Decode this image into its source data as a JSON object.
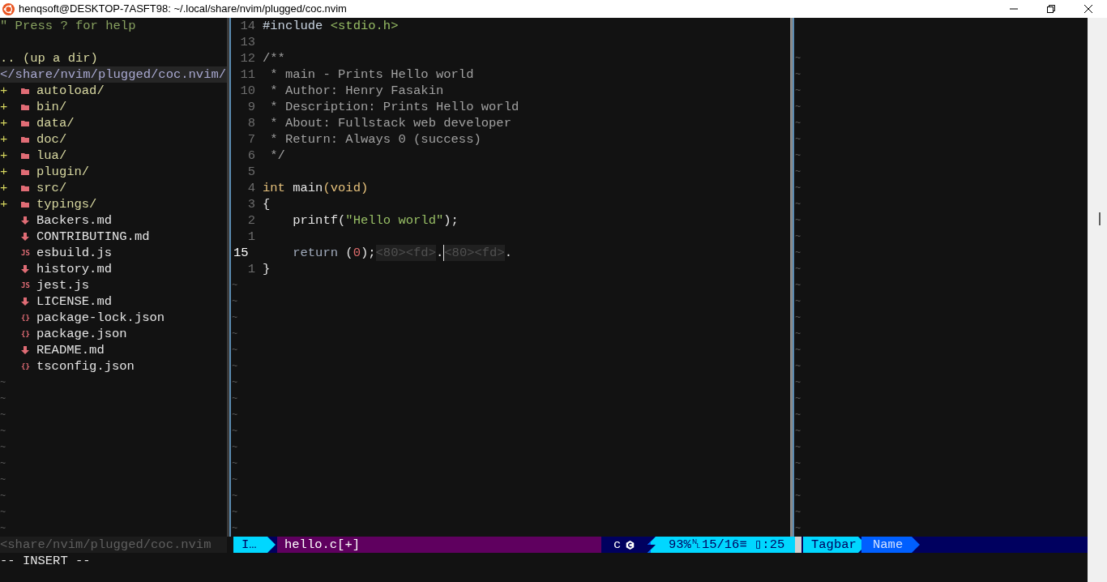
{
  "window": {
    "title": "henqsoft@DESKTOP-7ASFT98: ~/.local/share/nvim/plugged/coc.nvim"
  },
  "tree": {
    "help": "\" Press ? for help",
    "up_dir": ".. (up a dir)",
    "root": {
      "text": "</share/nvim/plugged/coc.nvim/",
      "cursor_line": true
    },
    "entries": [
      {
        "name": "autoload/",
        "kind": "dir",
        "marker": "+"
      },
      {
        "name": "bin/",
        "kind": "dir",
        "marker": "+"
      },
      {
        "name": "data/",
        "kind": "dir",
        "marker": "+"
      },
      {
        "name": "doc/",
        "kind": "dir",
        "marker": "+"
      },
      {
        "name": "lua/",
        "kind": "dir",
        "marker": "+"
      },
      {
        "name": "plugin/",
        "kind": "dir",
        "marker": "+"
      },
      {
        "name": "src/",
        "kind": "dir",
        "marker": "+"
      },
      {
        "name": "typings/",
        "kind": "dir",
        "marker": "+"
      },
      {
        "name": "Backers.md",
        "kind": "markdown"
      },
      {
        "name": "CONTRIBUTING.md",
        "kind": "markdown"
      },
      {
        "name": "esbuild.js",
        "kind": "labeled",
        "icon_text": "JS"
      },
      {
        "name": "history.md",
        "kind": "markdown"
      },
      {
        "name": "jest.js",
        "kind": "labeled",
        "icon_text": "JS"
      },
      {
        "name": "LICENSE.md",
        "kind": "markdown"
      },
      {
        "name": "package-lock.json",
        "kind": "labeled",
        "icon_text": "{}"
      },
      {
        "name": "package.json",
        "kind": "labeled",
        "icon_text": "{}"
      },
      {
        "name": "README.md",
        "kind": "markdown"
      },
      {
        "name": "tsconfig.json",
        "kind": "labeled",
        "icon_text": "{}"
      }
    ],
    "filler": [
      "~",
      "~",
      "~",
      "~",
      "~",
      "~",
      "~",
      "~",
      "~",
      "~"
    ]
  },
  "editor": {
    "lines": [
      {
        "number": "14",
        "current": false,
        "tokens": [
          {
            "text": "#include",
            "kind": "preproc"
          },
          {
            "text": " <stdio.h>",
            "kind": "string"
          }
        ]
      },
      {
        "number": "13",
        "current": false
      },
      {
        "number": "12",
        "current": false,
        "tokens": [
          {
            "text": "/**",
            "kind": "comment"
          }
        ]
      },
      {
        "number": "11",
        "current": false,
        "tokens": [
          {
            "text": " * main - Prints Hello world",
            "kind": "comment"
          }
        ]
      },
      {
        "number": "10",
        "current": false,
        "tokens": [
          {
            "text": " * Author: Henry Fasakin",
            "kind": "comment"
          }
        ]
      },
      {
        "number": "9",
        "current": false,
        "tokens": [
          {
            "text": " * Description: Prints Hello world",
            "kind": "comment"
          }
        ]
      },
      {
        "number": "8",
        "current": false,
        "tokens": [
          {
            "text": " * About: Fullstack web developer",
            "kind": "comment"
          }
        ]
      },
      {
        "number": "7",
        "current": false,
        "tokens": [
          {
            "text": " * Return: Always 0 (success)",
            "kind": "comment"
          }
        ]
      },
      {
        "number": "6",
        "current": false,
        "tokens": [
          {
            "text": " */",
            "kind": "comment"
          }
        ]
      },
      {
        "number": "5",
        "current": false
      },
      {
        "number": "4",
        "current": false,
        "tokens": [
          {
            "text": "int",
            "kind": "type"
          },
          {
            "text": " main",
            "kind": "plain"
          },
          {
            "text": "(void)",
            "kind": "type"
          }
        ]
      },
      {
        "number": "3",
        "current": false,
        "tokens": [
          {
            "text": "{",
            "kind": "plain"
          }
        ]
      },
      {
        "number": "2",
        "current": false,
        "tokens": [
          {
            "text": "    printf(",
            "kind": "plain"
          },
          {
            "text": "\"Hello world\"",
            "kind": "string"
          },
          {
            "text": ");",
            "kind": "plain"
          }
        ]
      },
      {
        "number": "1",
        "current": false
      },
      {
        "number": "15",
        "current": true,
        "tokens": [
          {
            "text": "    return",
            "kind": "keyword"
          },
          {
            "text": " (",
            "kind": "plain"
          },
          {
            "text": "0",
            "kind": "number"
          },
          {
            "text": ");",
            "kind": "plain"
          },
          {
            "text": "<80><fd>",
            "kind": "special"
          },
          {
            "text": ".",
            "kind": "plain"
          },
          {
            "text": "<80><fd>",
            "kind": "special",
            "cursor_before": true
          },
          {
            "text": ".",
            "kind": "plain"
          }
        ]
      },
      {
        "number": "1",
        "current": false,
        "tokens": [
          {
            "text": "}",
            "kind": "plain"
          }
        ]
      }
    ],
    "filler": [
      "~",
      "~",
      "~",
      "~",
      "~",
      "~",
      "~",
      "~",
      "~",
      "~",
      "~",
      "~",
      "~",
      "~",
      "~",
      "~"
    ]
  },
  "tagbar": {
    "filler": [
      "~",
      "~",
      "~",
      "~",
      "~",
      "~",
      "~",
      "~",
      "~",
      "~",
      "~",
      "~",
      "~",
      "~",
      "~",
      "~",
      "~",
      "~",
      "~",
      "~",
      "~",
      "~",
      "~",
      "~",
      "~",
      "~",
      "~",
      "~",
      "~",
      "~"
    ]
  },
  "status_line": {
    "left": {
      "text": "<share/nvim/plugged/coc.nvim"
    },
    "segments": [
      {
        "kind": "mode",
        "text": "I…"
      },
      {
        "kind": "file",
        "text": "hello.c[+]"
      },
      {
        "kind": "filetype",
        "text": "c"
      },
      {
        "kind": "position",
        "text": "93%␤15/16≡ ▯:25"
      },
      {
        "kind": "tagbar",
        "text": "Tagbar"
      },
      {
        "kind": "name",
        "text": "Name"
      }
    ]
  },
  "command_line": "-- INSERT --"
}
